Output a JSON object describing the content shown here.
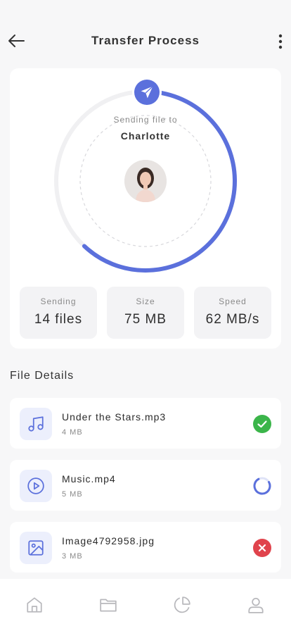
{
  "header": {
    "title": "Transfer Process",
    "back_icon": "arrow-left-icon",
    "menu_icon": "more-vertical-icon"
  },
  "transfer": {
    "sending_to_label": "Sending file to",
    "recipient_name": "Charlotte",
    "progress": 0.62,
    "accent_color": "#5b70dc"
  },
  "stats": [
    {
      "label": "Sending",
      "value": "14 files"
    },
    {
      "label": "Size",
      "value": "75 MB"
    },
    {
      "label": "Speed",
      "value": "62 MB/s"
    }
  ],
  "file_details": {
    "title": "File Details",
    "files": [
      {
        "name": "Under the Stars.mp3",
        "size": "4 MB",
        "icon": "music-note-icon",
        "status": "completed"
      },
      {
        "name": "Music.mp4",
        "size": "5 MB",
        "icon": "play-circle-icon",
        "status": "in-progress"
      },
      {
        "name": "Image4792958.jpg",
        "size": "3 MB",
        "icon": "image-icon",
        "status": "failed"
      }
    ]
  },
  "status_colors": {
    "completed": "#3bb54a",
    "in-progress": "#5b70dc",
    "failed": "#e0434c"
  },
  "bottom_nav": [
    "home-icon",
    "folder-icon",
    "pie-chart-icon",
    "user-icon"
  ]
}
